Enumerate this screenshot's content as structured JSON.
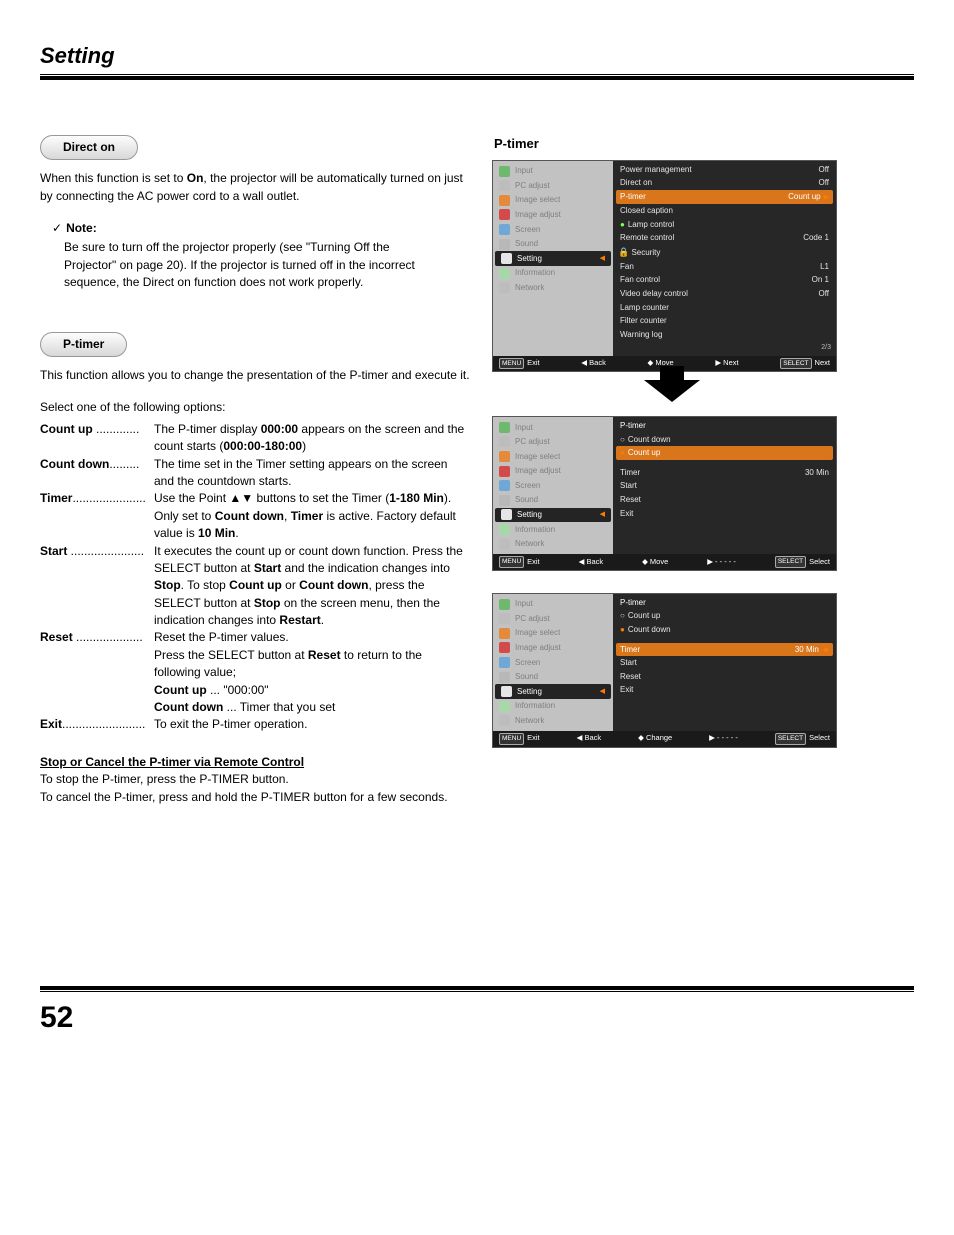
{
  "page": {
    "title": "Setting",
    "number": "52"
  },
  "directOn": {
    "heading": "Direct on",
    "para": "When this function is set to On, the projector will be automatically turned on just by connecting the AC power cord to a wall outlet.",
    "noteLabel": "Note:",
    "noteText": "Be sure to turn off the projector properly (see \"Turning Off the Projector\" on page 20). If the projector is turned off in the incorrect sequence, the Direct on function does not work properly."
  },
  "ptimer": {
    "heading": "P-timer",
    "intro": "This function allows you to change the presentation of the P-timer and execute it.",
    "selectLine": "Select one of the following options:",
    "options": {
      "countUp": {
        "label": "Count up",
        "desc": "The P-timer display 000:00 appears on the screen and the count starts (000:00-180:00)"
      },
      "countDown": {
        "label": "Count down",
        "desc": "The time set in the Timer setting appears on the screen and the countdown starts."
      },
      "timer": {
        "label": "Timer",
        "desc": "Use the Point ▲▼ buttons to set the Timer (1-180 Min). Only set to Count down, Timer is active. Factory default value is 10 Min."
      },
      "start": {
        "label": "Start",
        "desc": "It executes the count up or count down function. Press the SELECT button at Start and the indication changes into Stop. To stop Count up or Count down, press the SELECT button at Stop on the screen menu, then the indication changes into Restart."
      },
      "reset": {
        "label": "Reset",
        "desc": "Reset the P-timer values.",
        "desc2": "Press the SELECT button at Reset to return to the following value;",
        "desc3a": "Count up ... \"000:00\"",
        "desc3b": "Count down ... Timer that you set"
      },
      "exit": {
        "label": "Exit",
        "desc": "To exit the P-timer operation."
      }
    },
    "stopCancel": {
      "heading": "Stop or Cancel the P-timer via Remote Control",
      "line1": "To stop the P-timer, press the P-TIMER button.",
      "line2": "To cancel the P-timer, press and hold the P-TIMER button for a few seconds."
    }
  },
  "rightCol": {
    "title": "P-timer",
    "nav": [
      "Input",
      "PC adjust",
      "Image select",
      "Image adjust",
      "Screen",
      "Sound",
      "Setting",
      "Information",
      "Network"
    ],
    "panel1": {
      "rows": [
        {
          "l": "Power management",
          "r": "Off"
        },
        {
          "l": "Direct on",
          "r": "Off"
        },
        {
          "l": "P-timer",
          "r": "Count  up",
          "hl": true,
          "arrow": true
        },
        {
          "l": "Closed caption",
          "r": ""
        },
        {
          "l": "Lamp control",
          "r": "",
          "dot": "green"
        },
        {
          "l": "Remote control",
          "r": "Code 1"
        },
        {
          "l": "Security",
          "r": "",
          "lock": true
        },
        {
          "l": "Fan",
          "r": "L1"
        },
        {
          "l": "Fan control",
          "r": "On 1"
        },
        {
          "l": "Video delay control",
          "r": "Off"
        },
        {
          "l": "Lamp counter",
          "r": ""
        },
        {
          "l": "Filter counter",
          "r": ""
        },
        {
          "l": "Warning log",
          "r": ""
        }
      ],
      "page": "2/3",
      "footer": {
        "exit": "Exit",
        "back": "Back",
        "move": "Move",
        "next": "Next",
        "select": "Next"
      }
    },
    "panel2": {
      "title": "P-timer",
      "rows": [
        {
          "l": "Count down",
          "dot": "unfilled"
        },
        {
          "l": "Count up",
          "hl": true,
          "dot": "orange"
        },
        {
          "spacer": true
        },
        {
          "l": "Timer",
          "r": "30 Min"
        },
        {
          "l": "Start"
        },
        {
          "l": "Reset"
        },
        {
          "l": "Exit"
        }
      ],
      "footer": {
        "exit": "Exit",
        "back": "Back",
        "move": "Move",
        "next": "- - - - -",
        "select": "Select"
      }
    },
    "panel3": {
      "title": "P-timer",
      "rows": [
        {
          "l": "Count up",
          "dot": "unfilled"
        },
        {
          "l": "Count down",
          "dot": "orange"
        },
        {
          "spacer": true
        },
        {
          "l": "Timer",
          "r": "30 Min",
          "hl": true,
          "ud": true
        },
        {
          "l": "Start"
        },
        {
          "l": "Reset"
        },
        {
          "l": "Exit"
        }
      ],
      "footer": {
        "exit": "Exit",
        "back": "Back",
        "move": "Change",
        "next": "- - - - -",
        "select": "Select"
      }
    }
  }
}
